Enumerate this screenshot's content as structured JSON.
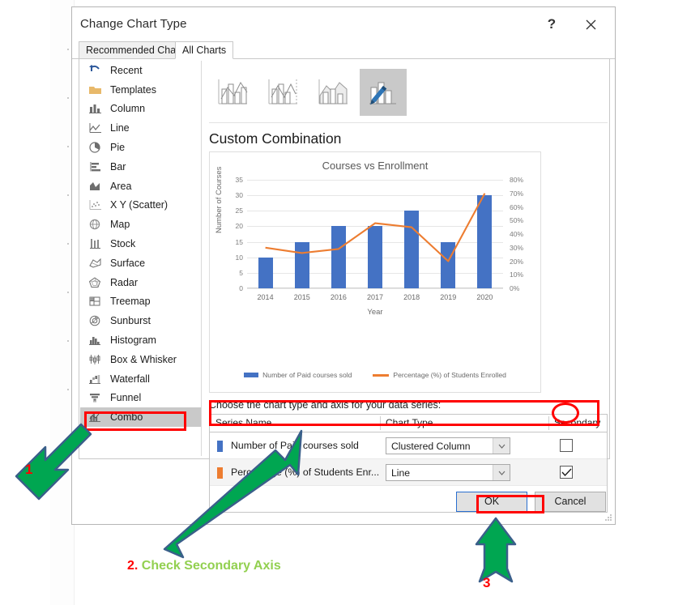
{
  "window": {
    "title": "Change Chart Type",
    "help_label": "?",
    "close_label": "✕"
  },
  "tabs": [
    {
      "label": "Recommended Charts",
      "active": false
    },
    {
      "label": "All Charts",
      "active": true
    }
  ],
  "sidebar": {
    "items": [
      {
        "label": "Recent",
        "icon": "recent-icon",
        "selected": false
      },
      {
        "label": "Templates",
        "icon": "templates-folder-icon",
        "selected": false
      },
      {
        "label": "Column",
        "icon": "column-chart-icon",
        "selected": false
      },
      {
        "label": "Line",
        "icon": "line-chart-icon",
        "selected": false
      },
      {
        "label": "Pie",
        "icon": "pie-chart-icon",
        "selected": false
      },
      {
        "label": "Bar",
        "icon": "bar-chart-icon",
        "selected": false
      },
      {
        "label": "Area",
        "icon": "area-chart-icon",
        "selected": false
      },
      {
        "label": "X Y (Scatter)",
        "icon": "scatter-chart-icon",
        "selected": false
      },
      {
        "label": "Map",
        "icon": "map-chart-icon",
        "selected": false
      },
      {
        "label": "Stock",
        "icon": "stock-chart-icon",
        "selected": false
      },
      {
        "label": "Surface",
        "icon": "surface-chart-icon",
        "selected": false
      },
      {
        "label": "Radar",
        "icon": "radar-chart-icon",
        "selected": false
      },
      {
        "label": "Treemap",
        "icon": "treemap-chart-icon",
        "selected": false
      },
      {
        "label": "Sunburst",
        "icon": "sunburst-chart-icon",
        "selected": false
      },
      {
        "label": "Histogram",
        "icon": "histogram-chart-icon",
        "selected": false
      },
      {
        "label": "Box & Whisker",
        "icon": "box-whisker-chart-icon",
        "selected": false
      },
      {
        "label": "Waterfall",
        "icon": "waterfall-chart-icon",
        "selected": false
      },
      {
        "label": "Funnel",
        "icon": "funnel-chart-icon",
        "selected": false
      },
      {
        "label": "Combo",
        "icon": "combo-chart-icon",
        "selected": true
      }
    ]
  },
  "right_panel": {
    "thumbnails": [
      {
        "name": "clustered-column-line",
        "selected": false
      },
      {
        "name": "clustered-column-line-on-secondary-axis",
        "selected": false
      },
      {
        "name": "stacked-area-clustered-column",
        "selected": false
      },
      {
        "name": "custom-combination",
        "selected": true
      }
    ],
    "heading": "Custom Combination",
    "chooser_label": "Choose the chart type and axis for your data series:",
    "table": {
      "headers": [
        "Series Name",
        "Chart Type",
        "Secondary Axis"
      ],
      "rows": [
        {
          "series_name": "Number of Paid courses sold",
          "swatch_color": "#4472C4",
          "chart_type": "Clustered Column",
          "secondary_axis_checked": false,
          "highlighted": false
        },
        {
          "series_name": "Percentage (%) of Students Enr...",
          "swatch_color": "#ED7D31",
          "chart_type": "Line",
          "secondary_axis_checked": true,
          "highlighted": true
        }
      ]
    }
  },
  "buttons": {
    "ok": "OK",
    "cancel": "Cancel"
  },
  "annotations": {
    "step1": {
      "number": "1"
    },
    "step2": {
      "number": "2.",
      "text": "Check Secondary Axis"
    },
    "step3": {
      "number": "3"
    },
    "highlight_color": "#FF0000",
    "arrow_color": "#00A651",
    "text_color": "#92D050"
  },
  "chart_data": {
    "type": "bar",
    "title": "Courses vs Enrollment",
    "xlabel": "Year",
    "ylabel": "Number of Courses",
    "categories": [
      "2014",
      "2015",
      "2016",
      "2017",
      "2018",
      "2019",
      "2020"
    ],
    "ylim": [
      0,
      35
    ],
    "yticks": [
      0,
      5,
      10,
      15,
      20,
      25,
      30,
      35
    ],
    "y2lim": [
      0,
      80
    ],
    "y2ticks": [
      "0%",
      "10%",
      "20%",
      "30%",
      "40%",
      "50%",
      "60%",
      "70%",
      "80%"
    ],
    "grid": true,
    "legend_position": "bottom",
    "series": [
      {
        "name": "Number of Paid courses sold",
        "type": "bar",
        "axis": "primary",
        "color": "#4472C4",
        "values": [
          10,
          15,
          20,
          20,
          25,
          15,
          30
        ]
      },
      {
        "name": "Percentage (%) of Students Enrolled",
        "type": "line",
        "axis": "secondary",
        "color": "#ED7D31",
        "values": [
          30,
          26,
          29,
          48,
          45,
          20,
          70
        ]
      }
    ]
  }
}
